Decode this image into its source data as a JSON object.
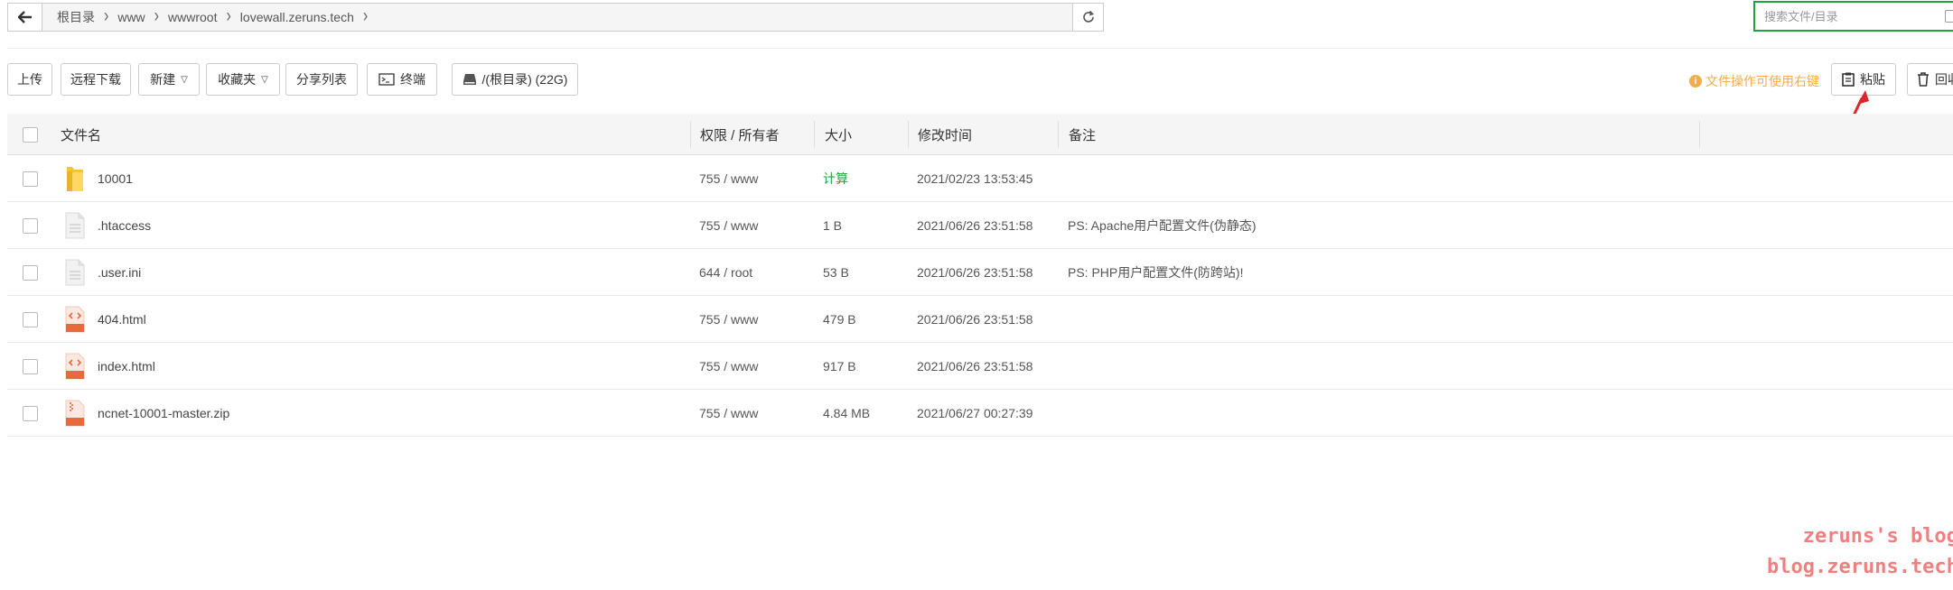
{
  "pathbar": {
    "breadcrumbs": [
      "根目录",
      "www",
      "wwwroot",
      "lovewall.zeruns.tech"
    ]
  },
  "search": {
    "placeholder": "搜索文件/目录"
  },
  "toolbar": {
    "upload": "上传",
    "remote_download": "远程下载",
    "new": "新建",
    "favorites": "收藏夹",
    "share_list": "分享列表",
    "terminal": "终端",
    "disk": "/(根目录) (22G)",
    "tip": "文件操作可使用右键",
    "paste": "粘贴",
    "recycle": "回收"
  },
  "table": {
    "headers": {
      "name": "文件名",
      "perm": "权限 / 所有者",
      "size": "大小",
      "mtime": "修改时间",
      "remark": "备注"
    },
    "rows": [
      {
        "name": "10001",
        "perm": "755 / www",
        "size": "计算",
        "mtime": "2021/02/23 13:53:45",
        "remark": "",
        "icon": "folder-icon"
      },
      {
        "name": ".htaccess",
        "perm": "755 / www",
        "size": "1 B",
        "mtime": "2021/06/26 23:51:58",
        "remark": "PS: Apache用户配置文件(伪静态)",
        "icon": "file-icon"
      },
      {
        "name": ".user.ini",
        "perm": "644 / root",
        "size": "53 B",
        "mtime": "2021/06/26 23:51:58",
        "remark": "PS: PHP用户配置文件(防跨站)!",
        "icon": "file-icon"
      },
      {
        "name": "404.html",
        "perm": "755 / www",
        "size": "479 B",
        "mtime": "2021/06/26 23:51:58",
        "remark": "",
        "icon": "html-file-icon"
      },
      {
        "name": "index.html",
        "perm": "755 / www",
        "size": "917 B",
        "mtime": "2021/06/26 23:51:58",
        "remark": "",
        "icon": "html-file-icon"
      },
      {
        "name": "ncnet-10001-master.zip",
        "perm": "755 / www",
        "size": "4.84 MB",
        "mtime": "2021/06/27 00:27:39",
        "remark": "",
        "icon": "zip-file-icon"
      }
    ]
  },
  "watermark": {
    "line1": "zeruns's blog",
    "line2": "blog.zeruns.tech"
  },
  "colors": {
    "accent": "#20a53a",
    "tip": "#f0ad4e",
    "annotation_arrow": "#e0242b",
    "watermark": "#f08080"
  }
}
